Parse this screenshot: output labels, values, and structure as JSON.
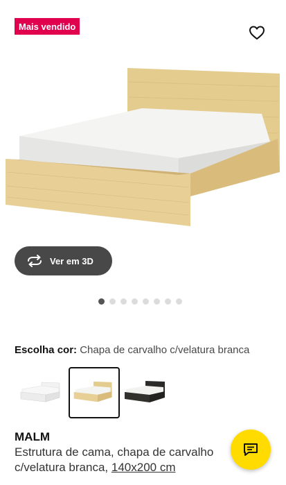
{
  "badge": {
    "label": "Mais vendido",
    "color": "#e0004d"
  },
  "favorite": {
    "icon": "heart-outline-icon"
  },
  "hero": {
    "alt_icon": "bed-product-image"
  },
  "view3d": {
    "label": "Ver em 3D",
    "icon": "rotate-3d-icon",
    "bg": "#484848"
  },
  "carousel": {
    "count": 8,
    "active_index": 0
  },
  "color_choice": {
    "label": "Escolha cor:",
    "value": "Chapa de carvalho c/velatura branca"
  },
  "swatches": [
    {
      "name": "white",
      "selected": false
    },
    {
      "name": "oak-veneer",
      "selected": true
    },
    {
      "name": "black-brown",
      "selected": false
    }
  ],
  "product": {
    "name": "MALM",
    "description": "Estrutura de cama, chapa de carvalho c/velatura branca,",
    "size": "140x200 cm"
  },
  "chat": {
    "icon": "chat-bubble-icon",
    "bg": "#ffdb00"
  }
}
